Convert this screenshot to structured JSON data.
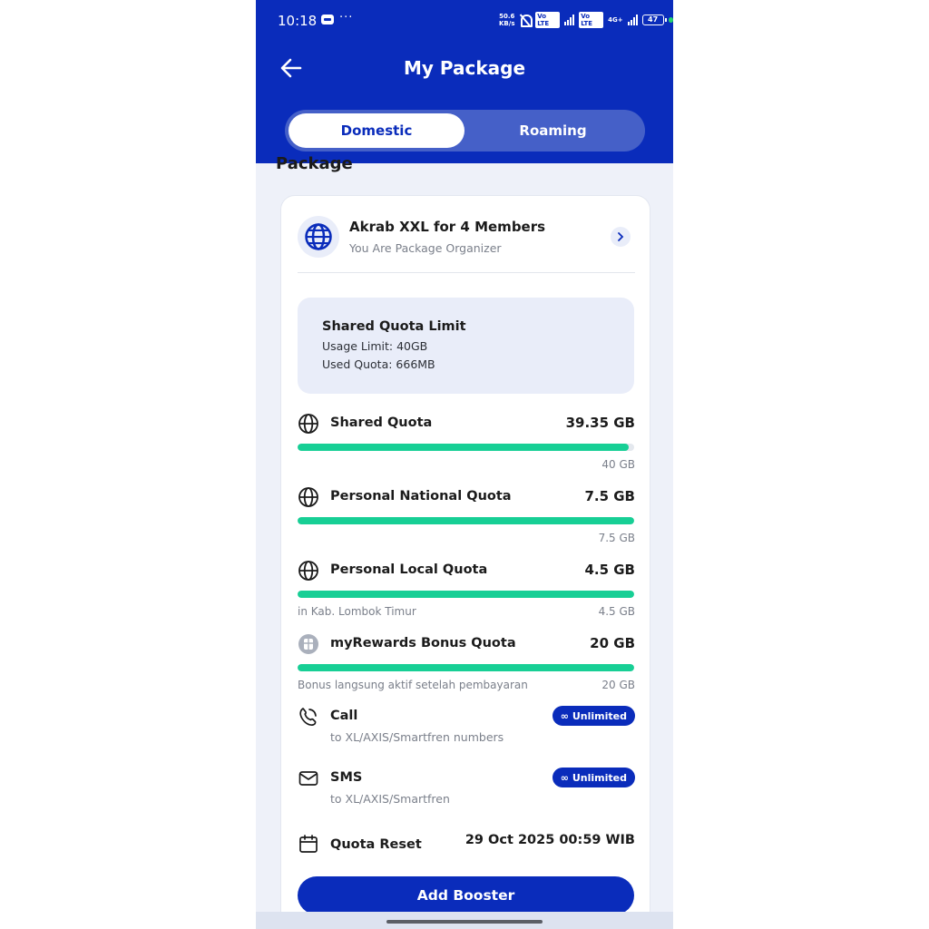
{
  "status_bar": {
    "time": "10:18",
    "dots": "···",
    "speed_top": "50.6",
    "speed_bottom": "KB/s",
    "net_badge_1": "Vo LTE",
    "net_badge_2": "Vo LTE",
    "network_type": "4G+",
    "battery": "47"
  },
  "header": {
    "title": "My Package",
    "tabs": [
      {
        "label": "Domestic",
        "active": true
      },
      {
        "label": "Roaming",
        "active": false
      }
    ]
  },
  "section_title": "Package",
  "package": {
    "name": "Akrab XXL for 4 Members",
    "subtitle": "You Are Package Organizer",
    "icon": "globe-icon"
  },
  "shared_limit": {
    "title": "Shared Quota Limit",
    "usage_limit": "Usage Limit: 40GB",
    "used_quota": "Used Quota: 666MB"
  },
  "quotas": [
    {
      "label": "Shared Quota",
      "value": "39.35 GB",
      "total": "40 GB",
      "note": "",
      "fill_fraction": 0.984,
      "icon": "globe-icon"
    },
    {
      "label": "Personal National Quota",
      "value": "7.5 GB",
      "total": "7.5 GB",
      "note": "",
      "fill_fraction": 1.0,
      "icon": "globe-icon"
    },
    {
      "label": "Personal Local Quota",
      "value": "4.5 GB",
      "total": "4.5 GB",
      "note": "in Kab. Lombok Timur",
      "fill_fraction": 1.0,
      "icon": "globe-icon"
    },
    {
      "label": "myRewards Bonus Quota",
      "value": "20 GB",
      "total": "20 GB",
      "note": "Bonus langsung aktif setelah pembayaran",
      "fill_fraction": 1.0,
      "icon": "rewards-icon"
    }
  ],
  "services": [
    {
      "label": "Call",
      "sub": "to XL/AXIS/Smartfren numbers",
      "badge": "Unlimited",
      "icon": "phone-icon"
    },
    {
      "label": "SMS",
      "sub": "to XL/AXIS/Smartfren",
      "badge": "Unlimited",
      "icon": "mail-icon"
    }
  ],
  "quota_reset": {
    "label": "Quota Reset",
    "value": "29 Oct 2025 00:59 WIB",
    "icon": "calendar-icon"
  },
  "add_booster_label": "Add Booster",
  "colors": {
    "brand_blue": "#0a2cbb",
    "progress_green": "#17cf95",
    "background": "#eef1f9"
  }
}
